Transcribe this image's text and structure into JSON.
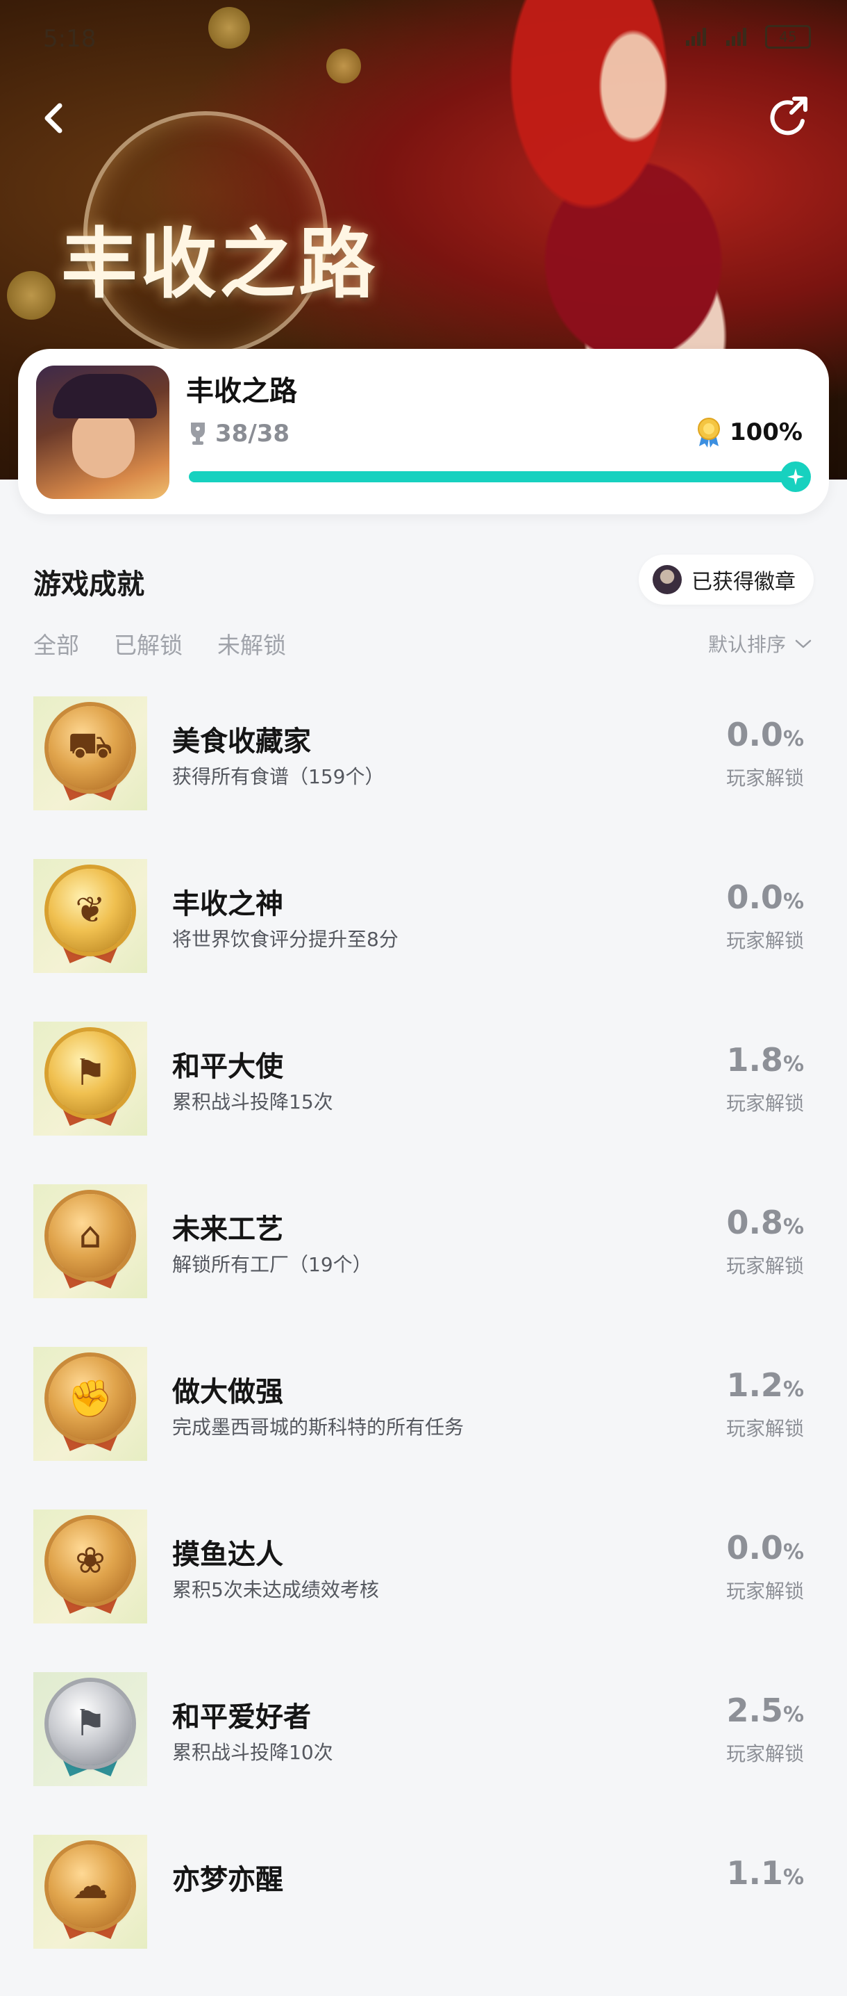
{
  "status_bar": {
    "time": "5:18",
    "battery": "45"
  },
  "banner": {
    "title": "丰收之路"
  },
  "game": {
    "name": "丰收之路",
    "trophy_count": "38/38",
    "completion_rate": "100%",
    "progress_fraction": 1.0
  },
  "section": {
    "title": "游戏成就",
    "badge_button": "已获得徽章"
  },
  "tabs": [
    {
      "label": "全部",
      "active": true
    },
    {
      "label": "已解锁",
      "active": false
    },
    {
      "label": "未解锁",
      "active": false
    }
  ],
  "sort": {
    "label": "默认排序"
  },
  "achievements": [
    {
      "title": "美食收藏家",
      "desc": "获得所有食谱（159个）",
      "pct": "0.0",
      "unit": "%",
      "sub": "玩家解锁",
      "medal": "bronze",
      "icon": "cart-icon"
    },
    {
      "title": "丰收之神",
      "desc": "将世界饮食评分提升至8分",
      "pct": "0.0",
      "unit": "%",
      "sub": "玩家解锁",
      "medal": "gold",
      "icon": "wheat-icon"
    },
    {
      "title": "和平大使",
      "desc": "累积战斗投降15次",
      "pct": "1.8",
      "unit": "%",
      "sub": "玩家解锁",
      "medal": "gold",
      "icon": "flag-icon"
    },
    {
      "title": "未来工艺",
      "desc": "解锁所有工厂（19个）",
      "pct": "0.8",
      "unit": "%",
      "sub": "玩家解锁",
      "medal": "bronze",
      "icon": "factory-icon"
    },
    {
      "title": "做大做强",
      "desc": "完成墨西哥城的斯科特的所有任务",
      "pct": "1.2",
      "unit": "%",
      "sub": "玩家解锁",
      "medal": "bronze",
      "icon": "fist-icon"
    },
    {
      "title": "摸鱼达人",
      "desc": "累积5次未达成绩效考核",
      "pct": "0.0",
      "unit": "%",
      "sub": "玩家解锁",
      "medal": "bronze",
      "icon": "fish-icon"
    },
    {
      "title": "和平爱好者",
      "desc": "累积战斗投降10次",
      "pct": "2.5",
      "unit": "%",
      "sub": "玩家解锁",
      "medal": "silver",
      "icon": "flag-icon"
    },
    {
      "title": "亦梦亦醒",
      "desc": "",
      "pct": "1.1",
      "unit": "%",
      "sub": "",
      "medal": "bronze",
      "icon": "cloud-icon"
    }
  ]
}
